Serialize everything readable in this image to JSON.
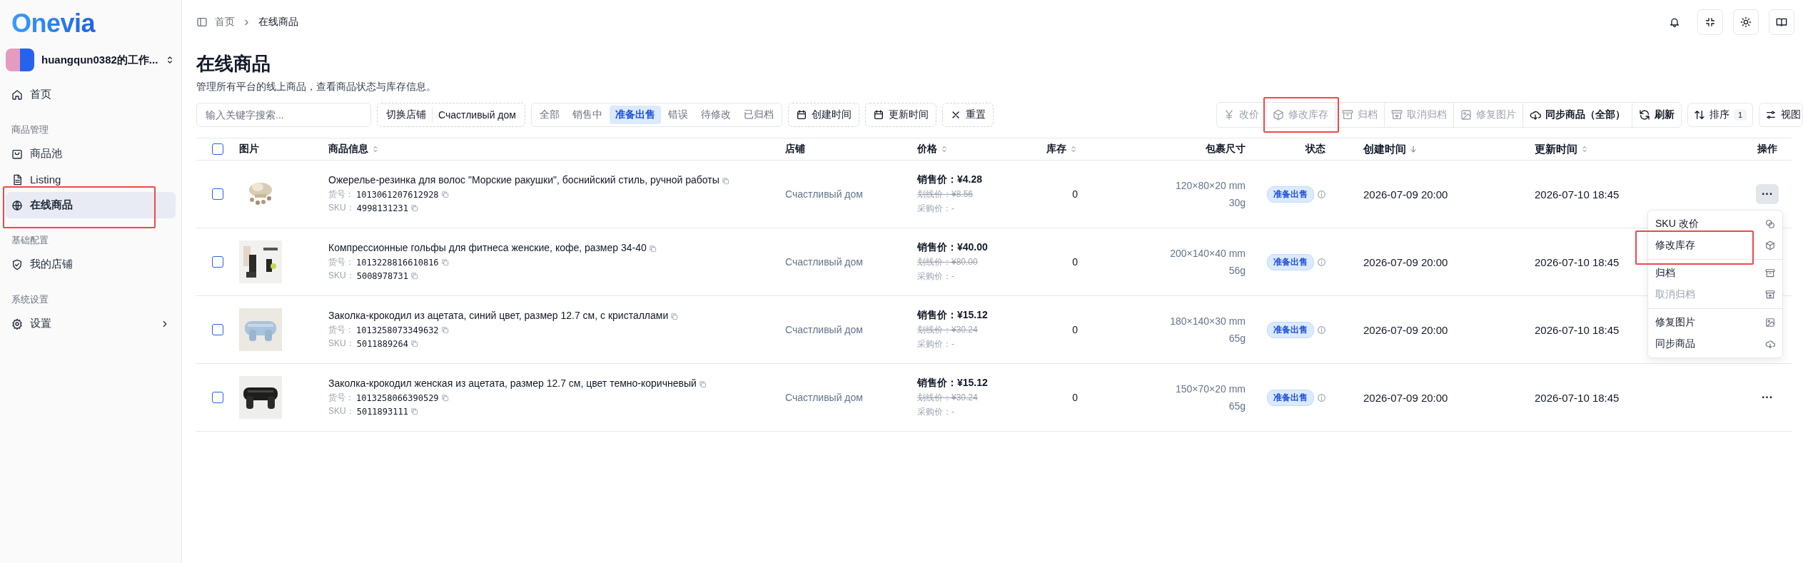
{
  "sidebar": {
    "logo": "Onevia",
    "workspace": "huangqun0382的工作...",
    "groups": [
      {
        "items": [
          {
            "label": "首页",
            "selected": false,
            "highlighted": false
          }
        ]
      },
      {
        "title": "商品管理",
        "items": [
          {
            "label": "商品池",
            "selected": false,
            "highlighted": false
          },
          {
            "label": "Listing",
            "selected": false,
            "highlighted": false
          },
          {
            "label": "在线商品",
            "selected": true,
            "highlighted": true
          }
        ]
      },
      {
        "title": "基础配置",
        "items": [
          {
            "label": "我的店铺",
            "selected": false,
            "highlighted": false
          }
        ]
      },
      {
        "title": "系统设置",
        "items": [
          {
            "label": "设置",
            "selected": false,
            "highlighted": false,
            "expandable": true
          }
        ]
      }
    ]
  },
  "breadcrumb": [
    "首页",
    "在线商品"
  ],
  "page": {
    "title": "在线商品",
    "subtitle": "管理所有平台的线上商品，查看商品状态与库存信息。"
  },
  "filters": {
    "search_placeholder": "输入关键字搜索...",
    "store_switch": {
      "label": "切换店铺",
      "value": "Счастливый дом"
    },
    "status_tabs": [
      {
        "label": "全部",
        "selected": false
      },
      {
        "label": "销售中",
        "selected": false
      },
      {
        "label": "准备出售",
        "selected": true
      },
      {
        "label": "错误",
        "selected": false
      },
      {
        "label": "待修改",
        "selected": false
      },
      {
        "label": "已归档",
        "selected": false
      }
    ],
    "date_buttons": [
      "创建时间",
      "更新时间"
    ],
    "reset": "重置"
  },
  "actions": [
    {
      "label": "改价",
      "disabled": true,
      "highlighted": false
    },
    {
      "label": "修改库存",
      "disabled": true,
      "highlighted": true
    },
    {
      "label": "归档",
      "disabled": true,
      "highlighted": false
    },
    {
      "label": "取消归档",
      "disabled": true,
      "highlighted": false
    },
    {
      "label": "修复图片",
      "disabled": true,
      "highlighted": false
    },
    {
      "label": "同步商品（全部）",
      "disabled": false,
      "highlighted": false
    },
    {
      "label": "刷新",
      "disabled": false,
      "highlighted": false
    }
  ],
  "sort": {
    "label": "排序",
    "count": "1"
  },
  "view": {
    "label": "视图"
  },
  "table": {
    "select_all": {
      "checked": false
    },
    "columns": [
      {
        "label": "图片",
        "sortable": false
      },
      {
        "label": "商品信息",
        "sortable": true,
        "sorted": false
      },
      {
        "label": "店铺",
        "sortable": false
      },
      {
        "label": "价格",
        "sortable": true,
        "sorted": false
      },
      {
        "label": "库存",
        "sortable": true,
        "sorted": false
      },
      {
        "label": "包裹尺寸",
        "sortable": false
      },
      {
        "label": "状态",
        "sortable": false
      },
      {
        "label": "创建时间",
        "sortable": true,
        "sorted": true
      },
      {
        "label": "更新时间",
        "sortable": true,
        "sorted": false
      },
      {
        "label": "操作",
        "sortable": false
      }
    ],
    "rows": [
      {
        "checked": false,
        "title": "Ожерелье-резинка для волос \"Морские ракушки\", боснийский стиль, ручной работы",
        "item_no_label": "货号：",
        "item_no": "1013061207612928",
        "sku_label": "SKU：",
        "sku": "4998131231",
        "store": "Счастливый дом",
        "sale_price": "销售价：¥4.28",
        "list_price": "划线价：¥8.56",
        "purchase_price": "采购价：-",
        "stock": "0",
        "size": "120×80×20 mm",
        "weight": "30g",
        "status": "准备出售",
        "created": "2026-07-09 20:00",
        "updated": "2026-07-10 18:45",
        "ops": "···",
        "ops_active": true
      },
      {
        "checked": false,
        "title": "Компрессионные гольфы для фитнеса женские, кофе, размер 34-40",
        "item_no_label": "货号：",
        "item_no": "1013228816610816",
        "sku_label": "SKU：",
        "sku": "5008978731",
        "store": "Счастливый дом",
        "sale_price": "销售价：¥40.00",
        "list_price": "划线价：¥80.00",
        "purchase_price": "采购价：-",
        "stock": "0",
        "size": "200×140×40 mm",
        "weight": "56g",
        "status": "准备出售",
        "created": "2026-07-09 20:00",
        "updated": "2026-07-10 18:45"
      },
      {
        "checked": false,
        "title": "Заколка-крокодил из ацетата, синий цвет, размер 12.7 см, с кристаллами",
        "item_no_label": "货号：",
        "item_no": "1013258073349632",
        "sku_label": "SKU：",
        "sku": "5011889264",
        "store": "Счастливый дом",
        "sale_price": "销售价：¥15.12",
        "list_price": "划线价：¥30.24",
        "purchase_price": "采购价：-",
        "stock": "0",
        "size": "180×140×30 mm",
        "weight": "65g",
        "status": "准备出售",
        "created": "2026-07-09 20:00",
        "updated": "2026-07-10 18:45"
      },
      {
        "checked": false,
        "title": "Заколка-крокодил женская из ацетата, размер 12.7 см, цвет темно-коричневый",
        "item_no_label": "货号：",
        "item_no": "1013258066390529",
        "sku_label": "SKU：",
        "sku": "5011893111",
        "store": "Счастливый дом",
        "sale_price": "销售价：¥15.12",
        "list_price": "划线价：¥30.24",
        "purchase_price": "采购价：-",
        "stock": "0",
        "size": "150×70×20 mm",
        "weight": "65g",
        "status": "准备出售",
        "created": "2026-07-09 20:00",
        "updated": "2026-07-10 18:45",
        "ops": "···",
        "ops_active": false
      }
    ]
  },
  "row_menu": {
    "items": [
      {
        "kind": "item",
        "label": "SKU 改价",
        "disabled": false,
        "highlighted": false
      },
      {
        "kind": "item",
        "label": "修改库存",
        "disabled": false,
        "highlighted": true
      },
      {
        "kind": "separator"
      },
      {
        "kind": "item",
        "label": "归档",
        "disabled": false,
        "highlighted": false
      },
      {
        "kind": "item",
        "label": "取消归档",
        "disabled": true,
        "highlighted": false
      },
      {
        "kind": "separator"
      },
      {
        "kind": "item",
        "label": "修复图片",
        "disabled": false,
        "highlighted": false
      },
      {
        "kind": "item",
        "label": "同步商品",
        "disabled": false,
        "highlighted": false
      }
    ]
  }
}
